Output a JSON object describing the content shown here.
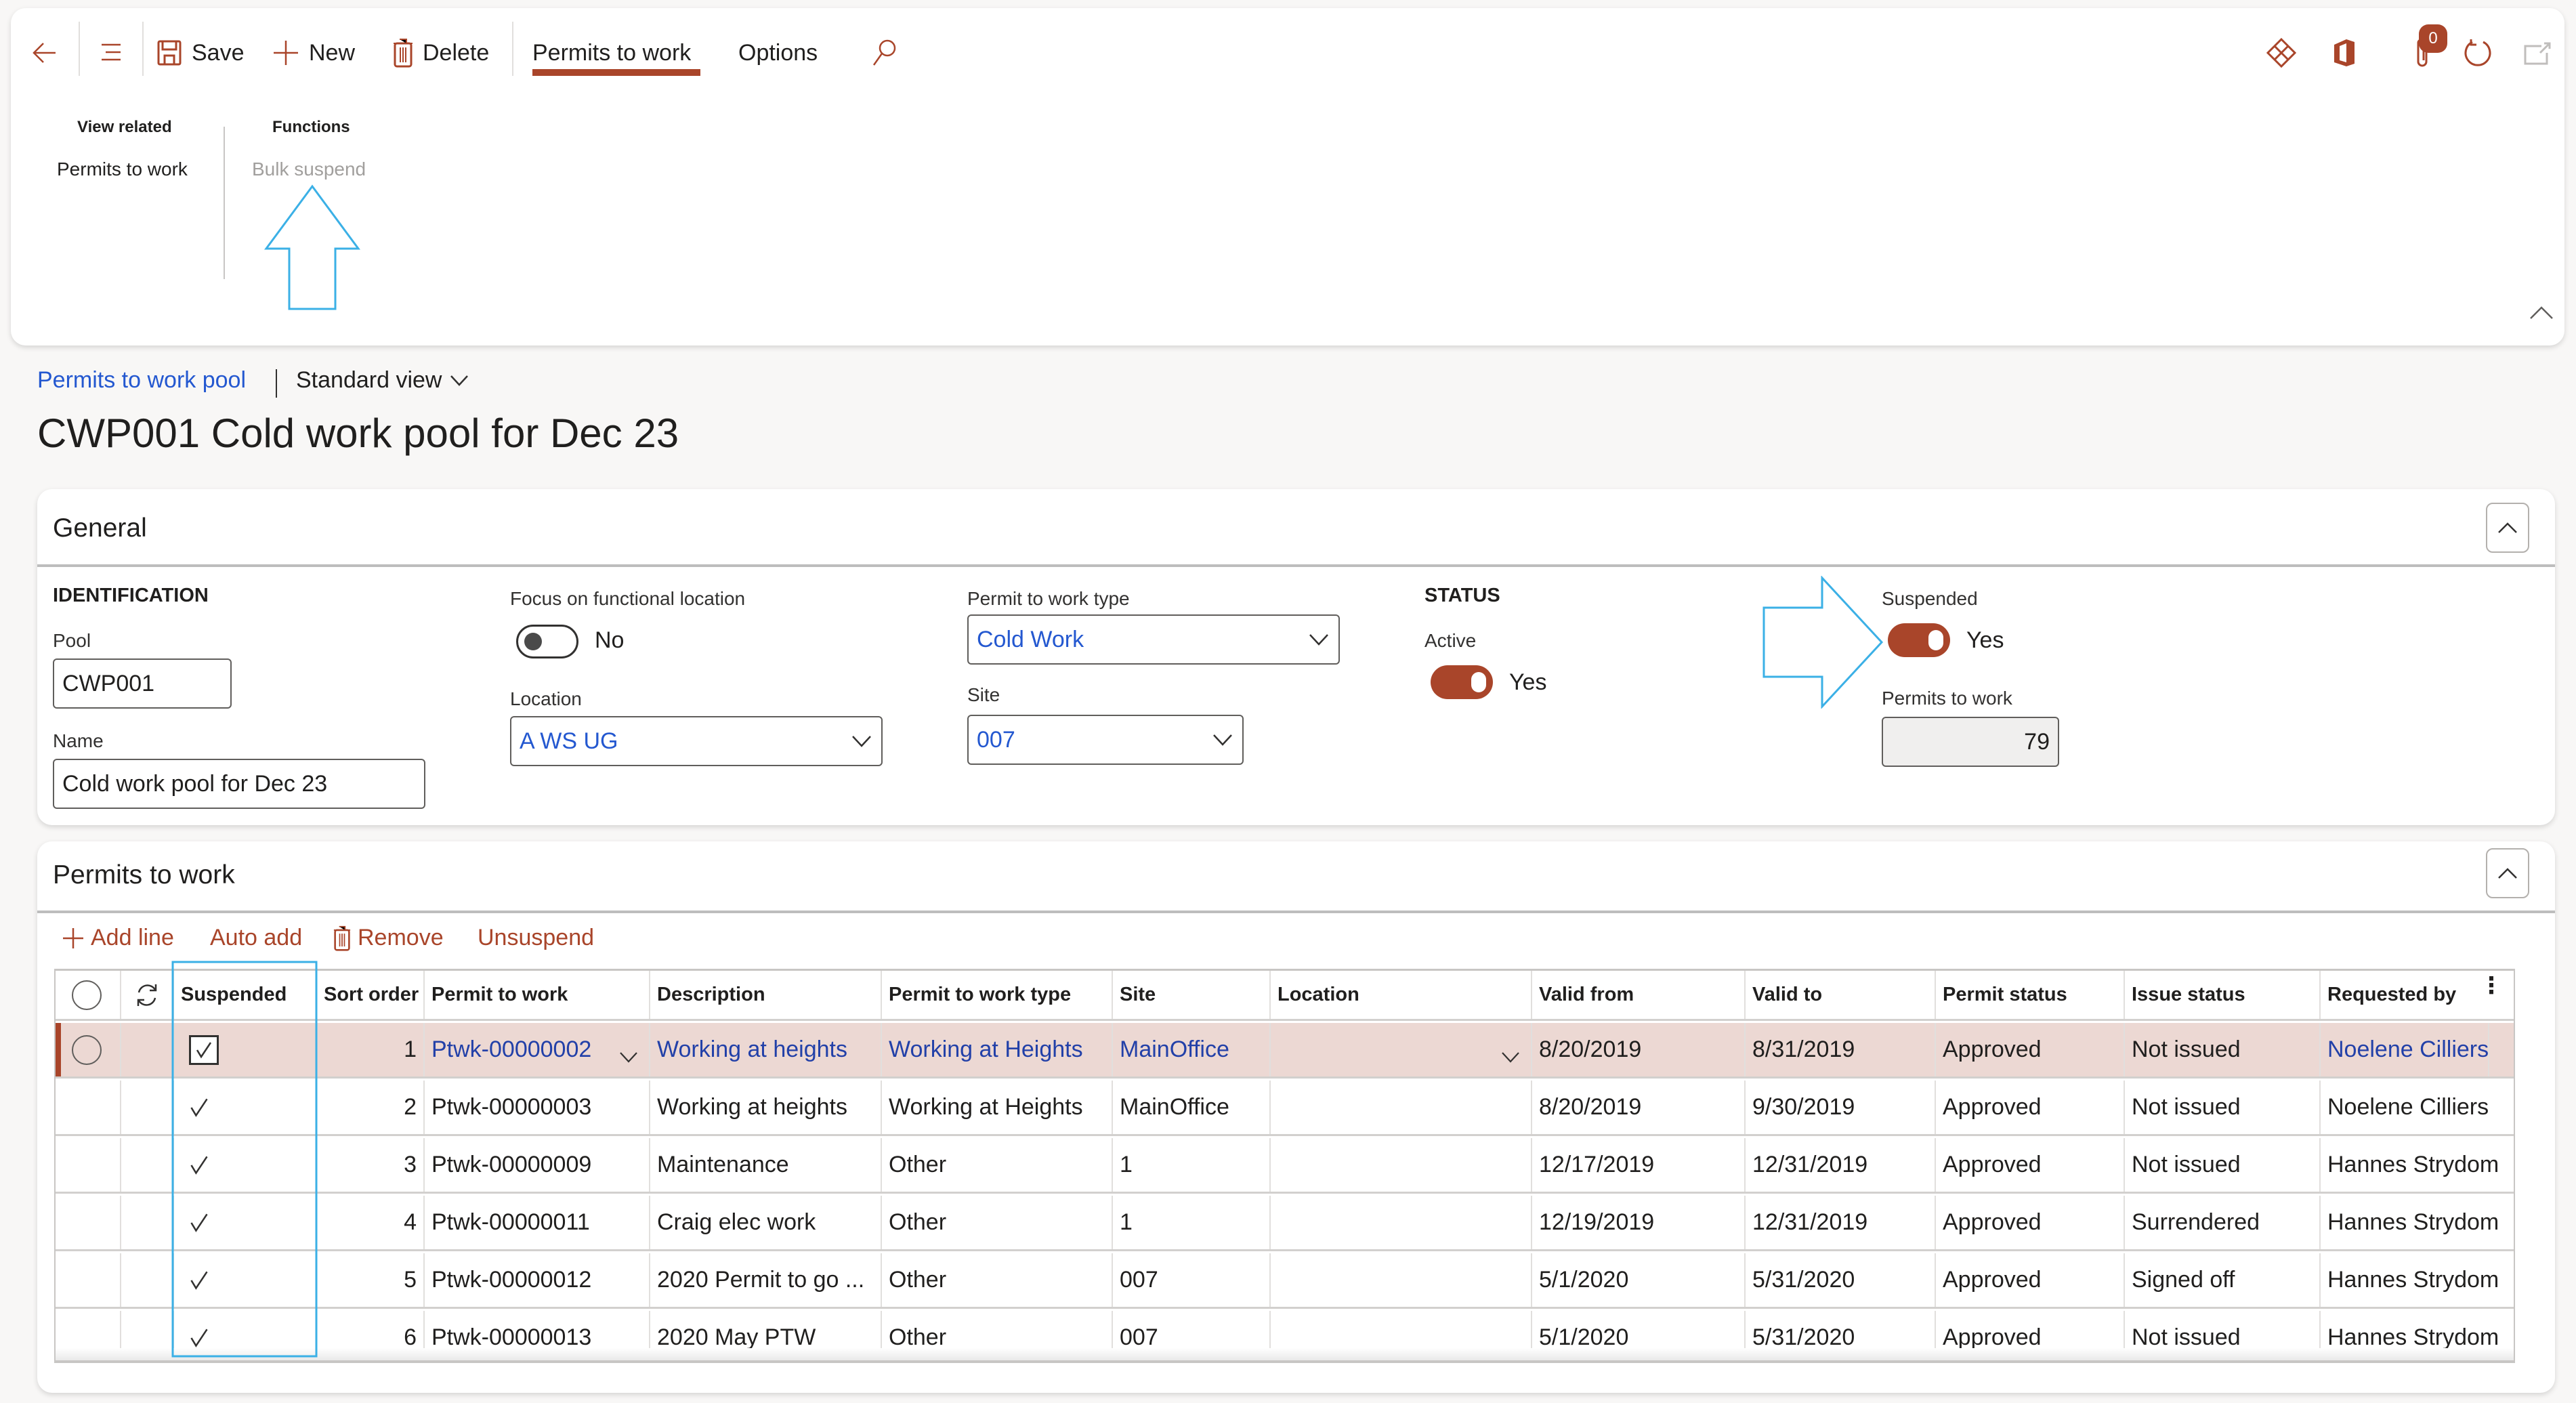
{
  "toolbar": {
    "save": "Save",
    "new": "New",
    "delete": "Delete",
    "tabs": [
      {
        "label": "Permits to work",
        "active": true
      },
      {
        "label": "Options",
        "active": false
      }
    ],
    "attachment_count": "0"
  },
  "action_pane": {
    "groups": [
      {
        "heading": "View related",
        "items": [
          "Permits to work"
        ]
      },
      {
        "heading": "Functions",
        "items": [
          "Bulk suspend"
        ],
        "disabled": true
      }
    ]
  },
  "breadcrumb": {
    "link": "Permits to work pool",
    "view": "Standard view"
  },
  "page_title": "CWP001 Cold work pool for Dec 23",
  "general": {
    "title": "General",
    "identification_heading": "IDENTIFICATION",
    "pool_label": "Pool",
    "pool_value": "CWP001",
    "name_label": "Name",
    "name_value": "Cold work pool for Dec 23",
    "focus_label": "Focus on functional location",
    "focus_value": "No",
    "location_label": "Location",
    "location_value": "A WS UG",
    "ptw_type_label": "Permit to work type",
    "ptw_type_value": "Cold Work",
    "site_label": "Site",
    "site_value": "007",
    "status_heading": "STATUS",
    "active_label": "Active",
    "active_value": "Yes",
    "suspended_label": "Suspended",
    "suspended_value": "Yes",
    "permits_count_label": "Permits to work",
    "permits_count_value": "79"
  },
  "permits": {
    "title": "Permits to work",
    "actions": {
      "add_line": "Add line",
      "auto_add": "Auto add",
      "remove": "Remove",
      "unsuspend": "Unsuspend"
    },
    "columns": [
      "Suspended",
      "Sort order",
      "Permit to work",
      "Description",
      "Permit to work type",
      "Site",
      "Location",
      "Valid from",
      "Valid to",
      "Permit status",
      "Issue status",
      "Requested by"
    ],
    "rows": [
      {
        "suspended": true,
        "sort": "1",
        "permit": "Ptwk-00000002",
        "desc": "Working at heights",
        "type": "Working at Heights",
        "site": "MainOffice",
        "location": "",
        "from": "8/20/2019",
        "to": "8/31/2019",
        "pstatus": "Approved",
        "istatus": "Not issued",
        "by": "Noelene Cilliers",
        "selected": true
      },
      {
        "suspended": true,
        "sort": "2",
        "permit": "Ptwk-00000003",
        "desc": "Working at heights",
        "type": "Working at Heights",
        "site": "MainOffice",
        "location": "",
        "from": "8/20/2019",
        "to": "9/30/2019",
        "pstatus": "Approved",
        "istatus": "Not issued",
        "by": "Noelene Cilliers"
      },
      {
        "suspended": true,
        "sort": "3",
        "permit": "Ptwk-00000009",
        "desc": "Maintenance",
        "type": "Other",
        "site": "1",
        "location": "",
        "from": "12/17/2019",
        "to": "12/31/2019",
        "pstatus": "Approved",
        "istatus": "Not issued",
        "by": "Hannes Strydom"
      },
      {
        "suspended": true,
        "sort": "4",
        "permit": "Ptwk-00000011",
        "desc": "Craig elec work",
        "type": "Other",
        "site": "1",
        "location": "",
        "from": "12/19/2019",
        "to": "12/31/2019",
        "pstatus": "Approved",
        "istatus": "Surrendered",
        "by": "Hannes Strydom"
      },
      {
        "suspended": true,
        "sort": "5",
        "permit": "Ptwk-00000012",
        "desc": "2020 Permit to go ...",
        "type": "Other",
        "site": "007",
        "location": "",
        "from": "5/1/2020",
        "to": "5/31/2020",
        "pstatus": "Approved",
        "istatus": "Signed off",
        "by": "Hannes Strydom"
      },
      {
        "suspended": true,
        "sort": "6",
        "permit": "Ptwk-00000013",
        "desc": "2020 May PTW",
        "type": "Other",
        "site": "007",
        "location": "",
        "from": "5/1/2020",
        "to": "5/31/2020",
        "pstatus": "Approved",
        "istatus": "Not issued",
        "by": "Hannes Strydom"
      }
    ]
  },
  "colors": {
    "accent": "#a9452a",
    "link": "#2458d0",
    "selected_row": "#ecd8d3",
    "annotation": "#3bb0e6"
  }
}
